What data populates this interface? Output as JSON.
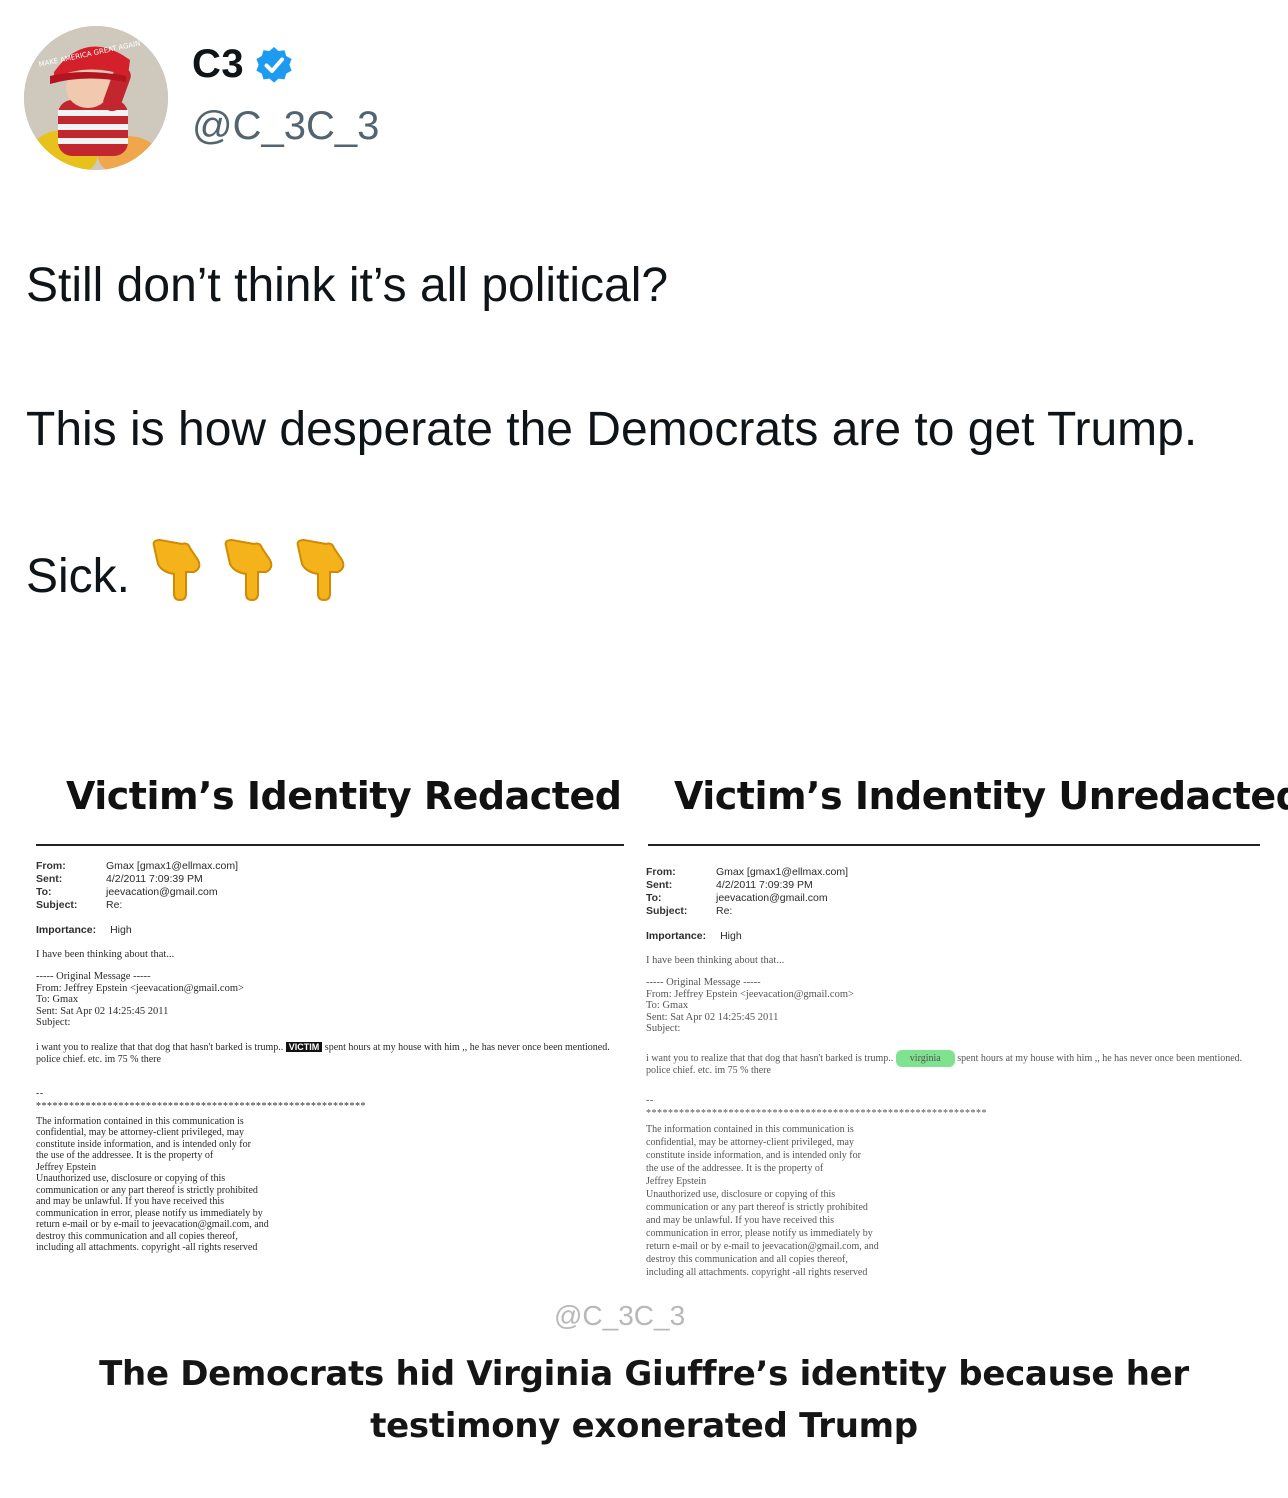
{
  "author": {
    "display_name": "C3",
    "handle": "@C_3C_3",
    "avatar_hat_text": "MAKE AMERICA GREAT AGAIN"
  },
  "tweet": {
    "line1": "Still don’t think it’s all political?",
    "line2": "This is how desperate the Democrats are to get Trump.",
    "line3": "Sick."
  },
  "embed": {
    "left_title": "Victim’s Identity Redacted",
    "right_title": "Victim’s Indentity Unredacted",
    "email": {
      "from_label": "From:",
      "sent_label": "Sent:",
      "to_label": "To:",
      "subject_label": "Subject:",
      "from": "Gmax [gmax1@ellmax.com]",
      "sent": "4/2/2011 7:09:39 PM",
      "to": "jeevacation@gmail.com",
      "subject": "Re:",
      "importance_label": "Importance:",
      "importance": "High",
      "reply": "I have been thinking about that...",
      "orig_header": "----- Original Message -----",
      "orig_from": "From: Jeffrey Epstein <jeevacation@gmail.com>",
      "orig_to": "To: Gmax",
      "orig_sent": "Sent: Sat Apr 02 14:25:45 2011",
      "orig_subject": "Subject:",
      "body_before": "i want you to realize that that dog that hasn't barked is trump..",
      "body_after": "spent hours at my house with him ,, he has never once been mentioned. police chief. etc. im 75 % there",
      "redacted_word": "VICTIM",
      "unredacted_word": "virginia",
      "dash": "--",
      "stars": "****************************************************************",
      "legal": [
        "The information contained in this communication is",
        "confidential, may be attorney-client privileged, may",
        "constitute inside information, and is intended only for",
        "the use of the addressee. It is the property of",
        "Jeffrey Epstein",
        "Unauthorized use, disclosure or copying of this",
        "communication or any part thereof is strictly prohibited",
        "and may be unlawful. If you have received this",
        "communication in error, please notify us immediately by",
        "return e-mail or by e-mail to jeevacation@gmail.com, and",
        "destroy this communication and all copies thereof,",
        "including all attachments. copyright -all rights reserved"
      ]
    },
    "watermark": "@C_3C_3",
    "caption": "The Democrats hid Virginia Giuffre’s identity because her testimony exonerated Trump"
  }
}
